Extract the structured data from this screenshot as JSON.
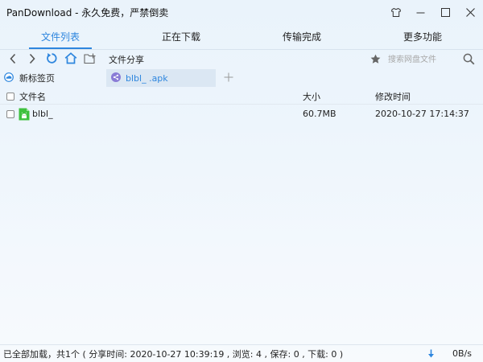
{
  "app": {
    "title": "PanDownload - 永久免费，严禁倒卖"
  },
  "window_controls": {
    "icons": [
      "shirt-icon",
      "minimize-icon",
      "maximize-icon",
      "close-icon"
    ]
  },
  "tabs": [
    {
      "label": "文件列表",
      "active": true
    },
    {
      "label": "正在下载",
      "active": false
    },
    {
      "label": "传输完成",
      "active": false
    },
    {
      "label": "更多功能",
      "active": false
    }
  ],
  "toolbar": {
    "path_label": "文件分享",
    "search_placeholder": "搜索网盘文件"
  },
  "page_tabs": {
    "new_tab_label": "新标签页",
    "open_tab_label": "blbl_          .apk"
  },
  "table": {
    "headers": {
      "name": "文件名",
      "size": "大小",
      "date": "修改时间"
    },
    "rows": [
      {
        "name": "blbl_",
        "size": "60.7MB",
        "date": "2020-10-27 17:14:37",
        "icon": "android-apk-icon"
      }
    ]
  },
  "status": {
    "text": "已全部加载，共1个 ( 分享时间: 2020-10-27 10:39:19 , 浏览: 4 , 保存: 0 , 下载: 0 )",
    "speed": "0B/s"
  },
  "colors": {
    "accent": "#2e86de",
    "android_green": "#3ec13e",
    "background": "#eaf3fb"
  }
}
